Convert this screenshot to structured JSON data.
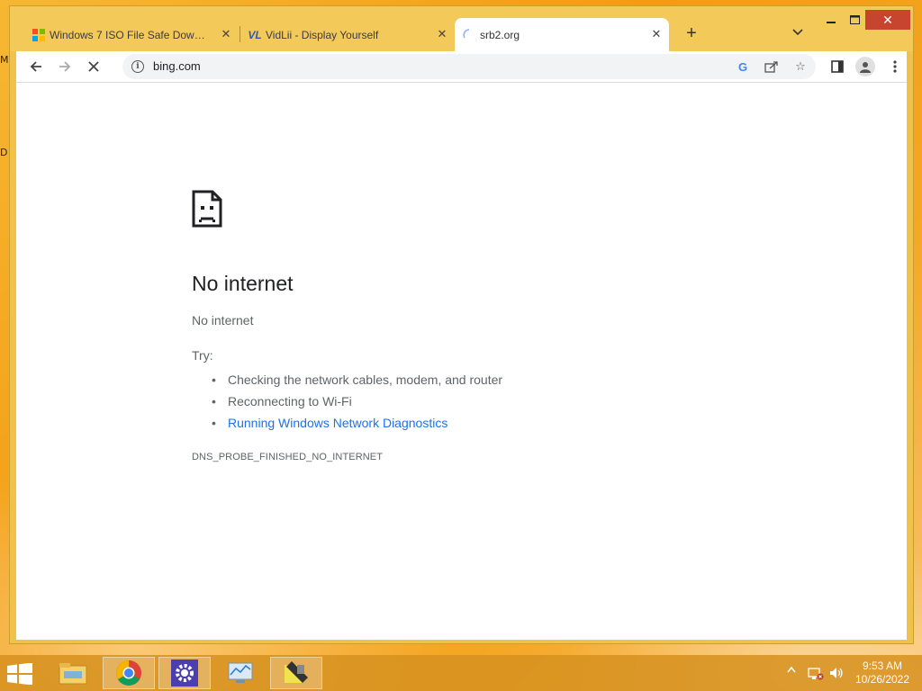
{
  "desktop": {
    "letter_top": "M",
    "letter_mid": "D"
  },
  "browser": {
    "tabs": [
      {
        "title": "Windows 7 ISO File Safe Downlo",
        "icon": "windows-logo-icon"
      },
      {
        "title": "VidLii - Display Yourself",
        "icon": "vidlii-logo-icon"
      },
      {
        "title": "srb2.org",
        "icon": "loading-spinner-icon",
        "active": true
      }
    ],
    "new_tab_label": "+",
    "address": {
      "url": "bing.com"
    }
  },
  "page": {
    "title": "No internet",
    "subtitle": "No internet",
    "try_label": "Try:",
    "suggestions": [
      "Checking the network cables, modem, and router",
      "Reconnecting to Wi-Fi",
      "Running Windows Network Diagnostics"
    ],
    "error_code": "DNS_PROBE_FINISHED_NO_INTERNET"
  },
  "taskbar": {
    "apps": [
      "file-explorer-icon",
      "chrome-icon",
      "settings-icon",
      "performance-monitor-icon",
      "paint-tool-icon"
    ],
    "clock": {
      "time": "9:53 AM",
      "date": "10/26/2022"
    }
  },
  "colors": {
    "titlebar": "#f3c95a",
    "close_button": "#c7442f",
    "link": "#1a73e8",
    "taskbar": "#d6911e"
  }
}
